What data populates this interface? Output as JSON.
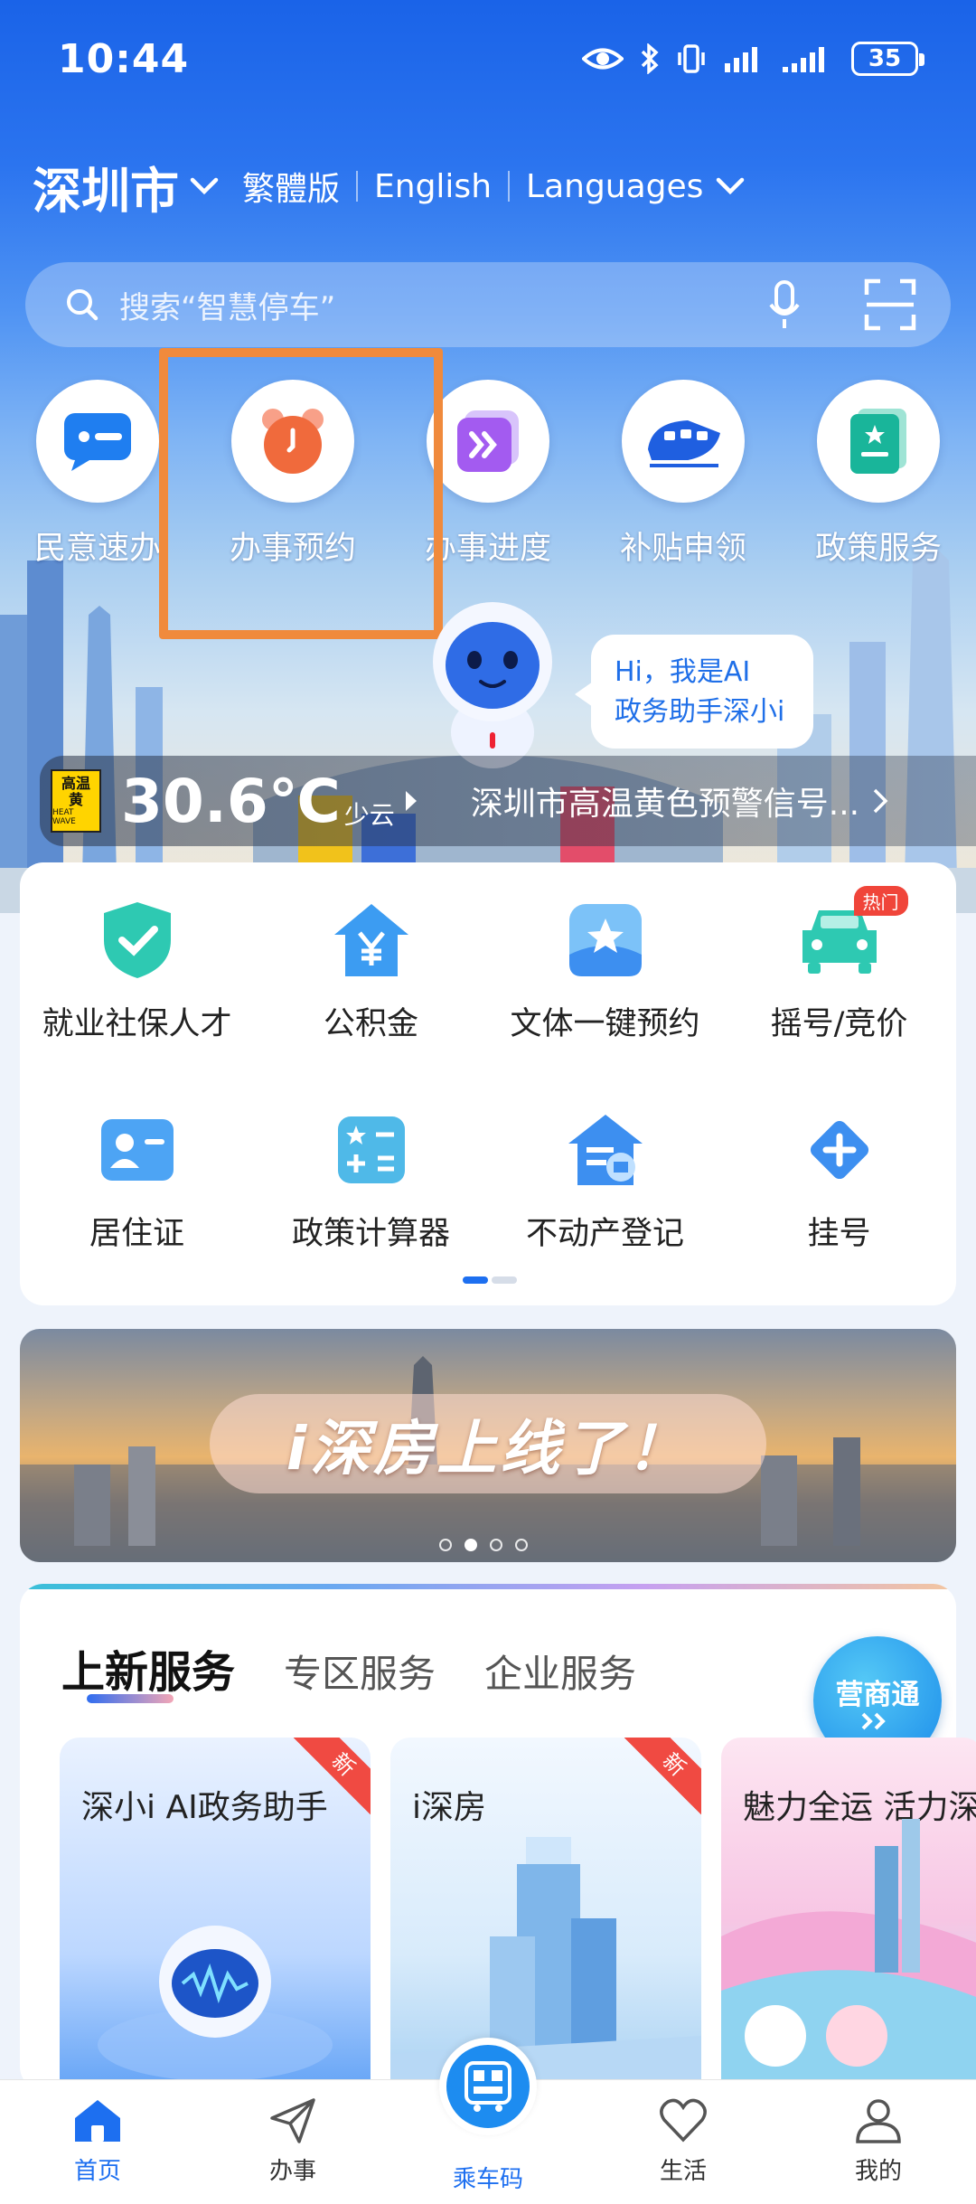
{
  "status_bar": {
    "time": "10:44",
    "battery": "35"
  },
  "header": {
    "city": "深圳市",
    "lang_traditional": "繁體版",
    "lang_english": "English",
    "lang_languages": "Languages"
  },
  "search": {
    "placeholder": "搜索“智慧停车”"
  },
  "quick_services": [
    {
      "label": "民意速办",
      "icon": "chat-bubble-icon",
      "color": "#1f7ef0"
    },
    {
      "label": "办事预约",
      "icon": "alarm-clock-icon",
      "color": "#f06a3c"
    },
    {
      "label": "办事进度",
      "icon": "progress-arrow-icon",
      "color": "#a35bf0"
    },
    {
      "label": "补贴申领",
      "icon": "train-icon",
      "color": "#1f5fe0"
    },
    {
      "label": "政策服务",
      "icon": "policy-book-icon",
      "color": "#19b59a"
    }
  ],
  "assistant": {
    "bubble_line1": "Hi，我是AI",
    "bubble_line2": "政务助手深小i"
  },
  "weather": {
    "icon_top": "高温",
    "icon_level": "黄",
    "icon_sub": "HEAT WAVE",
    "temperature": "30.6℃",
    "condition": "少云",
    "warning": "深圳市高温黄色预警信号..."
  },
  "service_grid": {
    "page": 1,
    "pages": 2,
    "items": [
      {
        "label": "就业社保人才",
        "icon": "shield-check-icon"
      },
      {
        "label": "公积金",
        "icon": "yuan-house-icon"
      },
      {
        "label": "文体一键预约",
        "icon": "star-badge-icon"
      },
      {
        "label": "摇号/竞价",
        "icon": "car-icon",
        "badge": "热门"
      },
      {
        "label": "居住证",
        "icon": "id-card-icon"
      },
      {
        "label": "政策计算器",
        "icon": "calculator-icon"
      },
      {
        "label": "不动产登记",
        "icon": "property-house-icon"
      },
      {
        "label": "挂号",
        "icon": "medical-cross-icon"
      }
    ]
  },
  "banner": {
    "text": "i深房上线了！",
    "current_slide": 2,
    "slide_count": 4
  },
  "new_services": {
    "tabs": [
      "上新服务",
      "专区服务",
      "企业服务"
    ],
    "active_tab": "上新服务",
    "float_button": "营商通",
    "tiles": [
      {
        "title": "深小i AI政务助手",
        "badge": "新"
      },
      {
        "title": "i深房",
        "badge": "新"
      },
      {
        "title": "魅力全运 活力深圳"
      }
    ]
  },
  "bottom_nav": [
    {
      "label": "首页",
      "icon": "home-icon",
      "active": true
    },
    {
      "label": "办事",
      "icon": "paper-plane-icon"
    },
    {
      "label": "乘车码",
      "icon": "bus-qr-icon"
    },
    {
      "label": "生活",
      "icon": "heart-icon"
    },
    {
      "label": "我的",
      "icon": "person-icon"
    }
  ]
}
